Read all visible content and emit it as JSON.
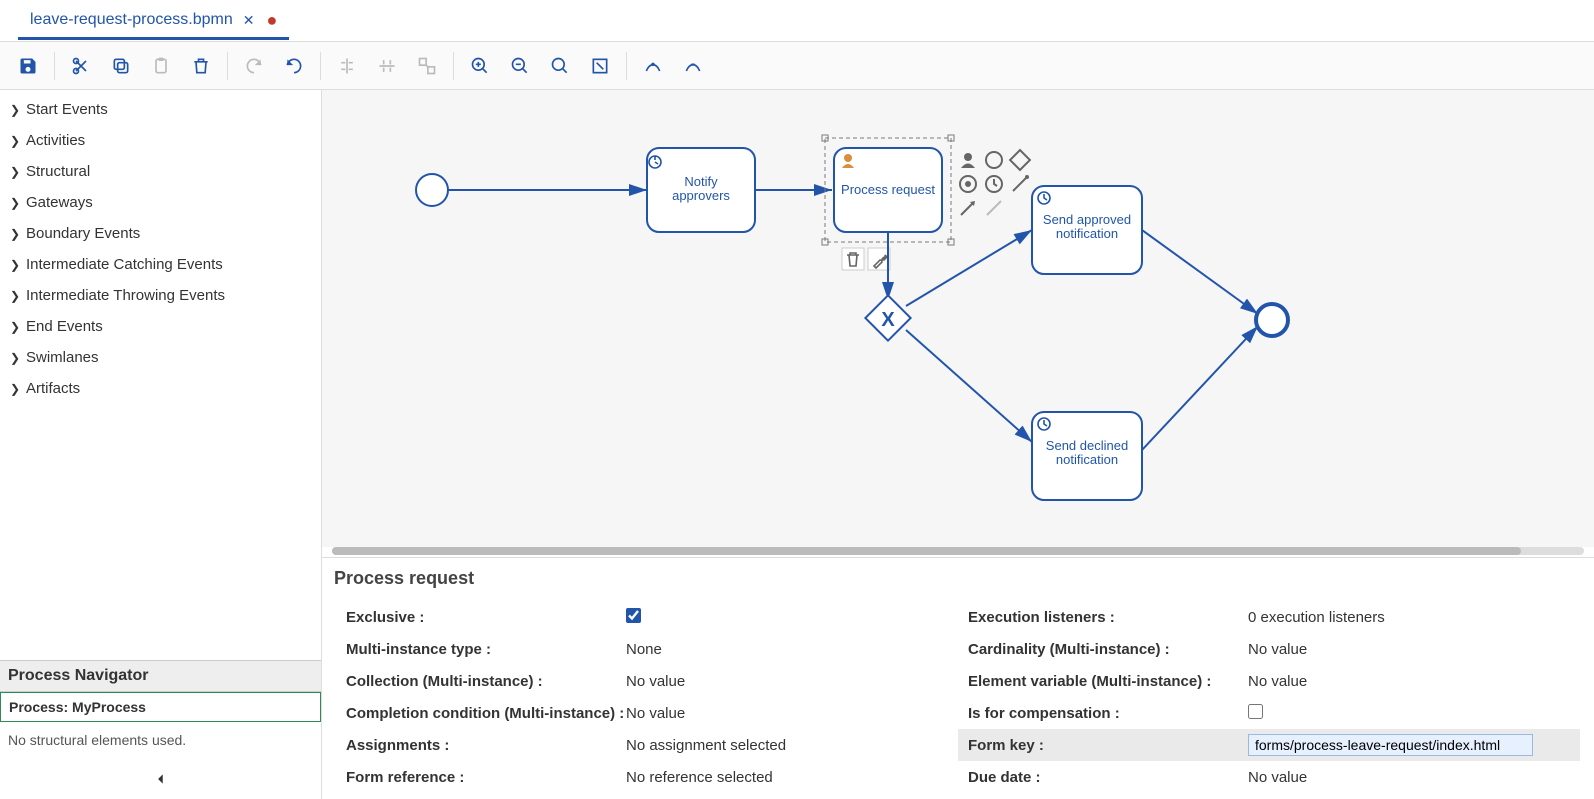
{
  "tab": {
    "filename": "leave-request-process.bpmn",
    "dirty": true
  },
  "palette": {
    "items": [
      "Start Events",
      "Activities",
      "Structural",
      "Gateways",
      "Boundary Events",
      "Intermediate Catching Events",
      "Intermediate Throwing Events",
      "End Events",
      "Swimlanes",
      "Artifacts"
    ]
  },
  "navigator": {
    "heading": "Process Navigator",
    "process_label": "Process: MyProcess",
    "empty": "No structural elements used."
  },
  "diagram": {
    "tasks": {
      "notify": "Notify approvers",
      "process": "Process request",
      "approved": "Send approved notification",
      "declined": "Send declined notification"
    }
  },
  "props": {
    "title": "Process request",
    "left": {
      "exclusive_l": "Exclusive :",
      "exclusive_v": true,
      "mi_type_l": "Multi-instance type :",
      "mi_type_v": "None",
      "coll_l": "Collection (Multi-instance) :",
      "coll_v": "No value",
      "compcond_l": "Completion condition (Multi-instance) :",
      "compcond_v": "No value",
      "assign_l": "Assignments :",
      "assign_v": "No assignment selected",
      "formref_l": "Form reference :",
      "formref_v": "No reference selected"
    },
    "right": {
      "exec_l": "Execution listeners :",
      "exec_v": "0 execution listeners",
      "card_l": "Cardinality (Multi-instance) :",
      "card_v": "No value",
      "elvar_l": "Element variable (Multi-instance) :",
      "elvar_v": "No value",
      "comp_l": "Is for compensation :",
      "comp_v": false,
      "formkey_l": "Form key :",
      "formkey_v": "forms/process-leave-request/index.html",
      "due_l": "Due date :",
      "due_v": "No value"
    }
  }
}
